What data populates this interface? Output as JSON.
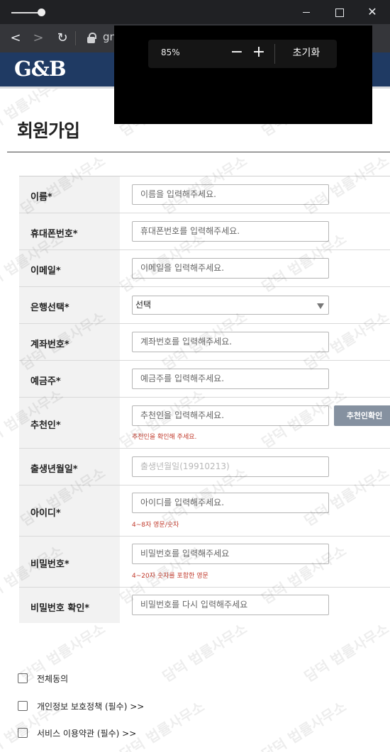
{
  "browser": {
    "url_text": "gn",
    "zoom": {
      "percent": "85%",
      "minus": "−",
      "plus": "+",
      "reset": "초기화"
    }
  },
  "site": {
    "logo": "G&B"
  },
  "page": {
    "title": "회원가입"
  },
  "form": {
    "name": {
      "label": "이름*",
      "placeholder": "이름을 입력해주세요."
    },
    "phone": {
      "label": "휴대폰번호*",
      "placeholder": "휴대폰번호를 입력해주세요."
    },
    "email": {
      "label": "이메일*",
      "placeholder": "이메일을 입력해주세요."
    },
    "bank": {
      "label": "은행선택*",
      "selected": "선택"
    },
    "account": {
      "label": "계좌번호*",
      "placeholder": "계좌번호를 입력해주세요."
    },
    "holder": {
      "label": "예금주*",
      "placeholder": "예금주를 입력해주세요."
    },
    "referrer": {
      "label": "추천인*",
      "placeholder": "추천인을 입력해주세요.",
      "button": "추천인확인",
      "hint": "추천인을 확인해 주세요."
    },
    "birth": {
      "label": "출생년월일*",
      "placeholder": "출생년월일(19910213)"
    },
    "userid": {
      "label": "아이디*",
      "placeholder": "아이디를 입력해주세요.",
      "hint": "4~8자 영문/숫자"
    },
    "password": {
      "label": "비밀번호*",
      "placeholder": "비밀번호를 입력해주세요",
      "hint": "4~20자 숫자를 포함한 영문"
    },
    "password_confirm": {
      "label": "비밀번호 확인*",
      "placeholder": "비밀번호를 다시 입력해주세요"
    }
  },
  "agreements": {
    "all": "전체동의",
    "privacy": "개인정보 보호정책 (필수) >>",
    "terms": "서비스 이용약관 (필수) >>"
  },
  "watermark": "담덕 법률사무소",
  "colors": {
    "header": "#1f3a63",
    "hint": "#c0392b",
    "button": "#8591a0"
  }
}
